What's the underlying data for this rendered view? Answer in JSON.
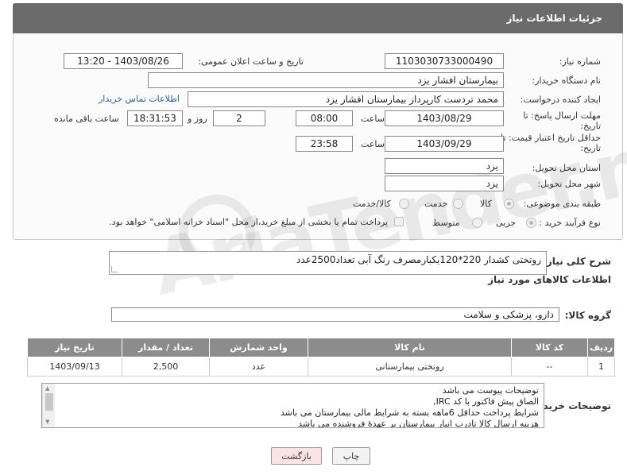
{
  "header": {
    "title": "جزئیات اطلاعات نیاز"
  },
  "form": {
    "need_number": {
      "label": "شماره نیاز:",
      "value": "1103030733000490"
    },
    "announce_datetime": {
      "label": "تاریخ و ساعت اعلان عمومی:",
      "value": "1403/08/26 - 13:20"
    },
    "buyer_org": {
      "label": "نام دستگاه خریدار:",
      "value": "بیمارستان افشار یزد"
    },
    "requester": {
      "label": "ایجاد کننده درخواست:",
      "value": "محمد تردست کارپرداز بیمارستان افشار یزد",
      "contact_link": "اطلاعات تماس خریدار"
    },
    "reply_deadline": {
      "label_line1": "مهلت ارسال پاسخ: تا",
      "label_line2": "تاریخ:",
      "date": "1403/08/29",
      "time_label": "ساعت",
      "time": "08:00",
      "days": "2",
      "days_label": "روز و",
      "remaining": "18:31:53",
      "remaining_label": "ساعت باقی مانده"
    },
    "price_validity": {
      "label_line1": "حداقل تاریخ اعتبار قیمت: تا",
      "label_line2": "تاریخ:",
      "date": "1403/09/29",
      "time_label": "ساعت",
      "time": "23:58"
    },
    "delivery_province": {
      "label": "استان محل تحویل:",
      "value": "یزد"
    },
    "delivery_city": {
      "label": "شهر محل تحویل:",
      "value": "یزد"
    },
    "category": {
      "label": "طبقه بندی موضوعی:",
      "options": [
        "کالا",
        "خدمت",
        "کالا/خدمت"
      ],
      "selected": "کالا"
    },
    "purchase_process": {
      "label": "نوع فرآیند خرید :",
      "options": [
        "جزیی",
        "متوسط"
      ],
      "selected": "جزیی",
      "payment_note": "پرداخت تمام یا بخشی از مبلغ خرید،از محل \"اسناد خزانه اسلامی\" خواهد بود."
    }
  },
  "watermark": {
    "text": "AriaTender.neT"
  },
  "summary": {
    "label": "شرح کلی نیاز:",
    "value": "روتختی کشدار 220*120یکبارمصرف رنگ آبی تعداد2500عدد"
  },
  "goods_section": {
    "title": "اطلاعات کالاهای مورد نیاز"
  },
  "goods_group": {
    "label": "گروه کالا:",
    "value": "دارو، پزشکی و سلامت"
  },
  "items_table": {
    "headers": [
      "ردیف",
      "کد کالا",
      "نام کالا",
      "واحد شمارش",
      "تعداد / مقدار",
      "تاریخ نیاز"
    ],
    "rows": [
      {
        "row": "1",
        "code": "--",
        "name": "روتختی بیمارستانی",
        "unit": "عدد",
        "qty": "2,500",
        "date": "1403/09/13"
      }
    ]
  },
  "buyer_notes": {
    "label": "توضیحات خریدار:",
    "lines": [
      "توضیحات پیوست می باشد",
      "الصاق پیش فاکتور با کد  IRC,",
      "شرایط پرداخت   حداقل 6ماهه بسته به شرایط مالی بیمارستان می باشد",
      "هزینه ارسال کالا تادرب انبار بیمارستان بر عهدهٔ فروشنده می باشد"
    ]
  },
  "actions": {
    "print": "چاپ",
    "back": "بازگشت"
  },
  "colors": {
    "header_bg": "#6b6b6b",
    "table_header_bg": "#8c8c8c",
    "link": "#2a5db0",
    "back_bg": "#fbe3e3"
  }
}
